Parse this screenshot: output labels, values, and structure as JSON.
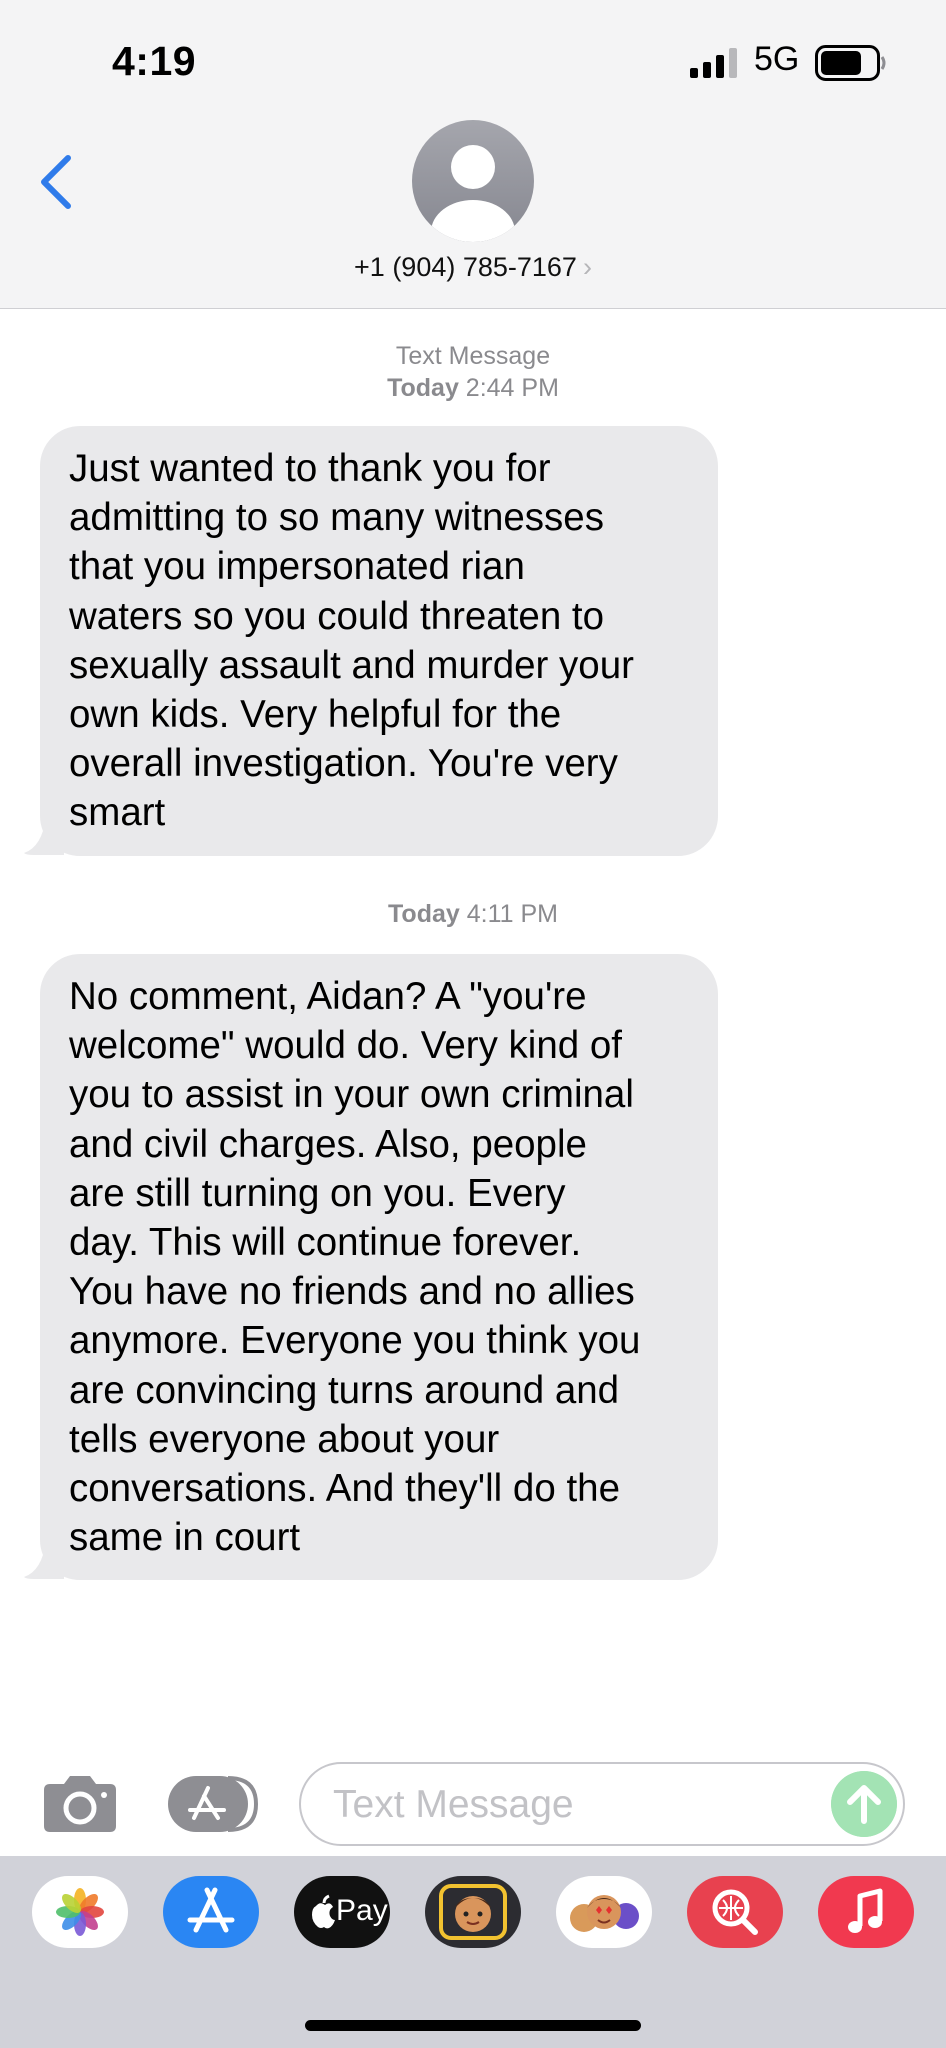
{
  "status_bar": {
    "time": "4:19",
    "network": "5G"
  },
  "header": {
    "contact": "+1 (904) 785-7167",
    "chevron": "›"
  },
  "messages": [
    {
      "service": "Text Message",
      "day": "Today",
      "time": "2:44 PM",
      "text": "Just wanted to thank you for\nadmitting to so many witnesses\nthat you impersonated rian\nwaters so you could threaten to\nsexually assault and murder your\nown kids. Very helpful for the\noverall investigation. You're very\nsmart"
    },
    {
      "day": "Today",
      "time": "4:11 PM",
      "text": "No comment, Aidan? A \"you're\nwelcome\" would do. Very kind of\nyou to assist in your own criminal\nand civil charges. Also, people\nare still turning on you. Every\nday. This will continue forever.\nYou have no friends and no allies\nanymore. Everyone you think you\nare convincing turns around and\ntells everyone about your\nconversations. And they'll do the\nsame in court"
    }
  ],
  "compose": {
    "placeholder": "Text Message",
    "value": ""
  },
  "drawer": {
    "apps": [
      {
        "name": "photos-icon"
      },
      {
        "name": "app-store-icon"
      },
      {
        "name": "apple-pay-icon",
        "label": "Pay"
      },
      {
        "name": "memoji-icon"
      },
      {
        "name": "memoji-stickers-icon"
      },
      {
        "name": "images-search-icon"
      },
      {
        "name": "music-icon"
      }
    ]
  },
  "colors": {
    "accent": "#2f7bea",
    "bubble": "#e9e9eb",
    "send_disabled": "#a3e3b4",
    "header_bg": "#f4f4f5"
  }
}
